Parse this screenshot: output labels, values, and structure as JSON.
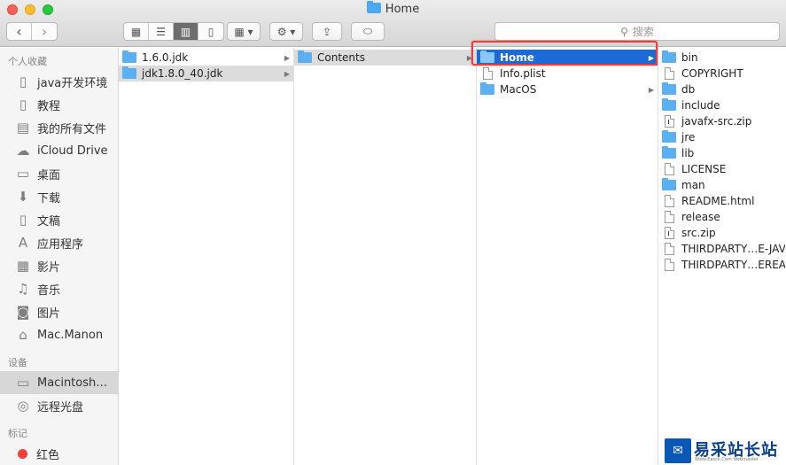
{
  "window": {
    "title": "Home",
    "buttons": {
      "close": "close",
      "minimize": "minimize",
      "zoom": "zoom"
    }
  },
  "toolbar": {
    "back_glyph": "‹",
    "forward_glyph": "›",
    "views": [
      {
        "name": "icon-view",
        "glyph": "▦",
        "active": false
      },
      {
        "name": "list-view",
        "glyph": "☰",
        "active": false
      },
      {
        "name": "column-view",
        "glyph": "▥",
        "active": true
      },
      {
        "name": "coverflow-view",
        "glyph": "▯",
        "active": false
      }
    ],
    "arrange_glyph": "▦ ▾",
    "action_glyph": "⚙ ▾",
    "share_glyph": "⇪",
    "tags_glyph": "⬭",
    "search_placeholder": "搜索"
  },
  "sidebar": {
    "sections": [
      {
        "heading": "个人收藏",
        "items": [
          {
            "label": "java开发环境",
            "icon": "document-icon",
            "glyph": "▯"
          },
          {
            "label": "教程",
            "icon": "document-icon",
            "glyph": "▯"
          },
          {
            "label": "我的所有文件",
            "icon": "all-files-icon",
            "glyph": "▤"
          },
          {
            "label": "iCloud Drive",
            "icon": "cloud-icon",
            "glyph": "☁"
          },
          {
            "label": "桌面",
            "icon": "desktop-icon",
            "glyph": "▭"
          },
          {
            "label": "下载",
            "icon": "download-icon",
            "glyph": "⬇"
          },
          {
            "label": "文稿",
            "icon": "documents-icon",
            "glyph": "▯"
          },
          {
            "label": "应用程序",
            "icon": "applications-icon",
            "glyph": "A"
          },
          {
            "label": "影片",
            "icon": "movies-icon",
            "glyph": "▦"
          },
          {
            "label": "音乐",
            "icon": "music-icon",
            "glyph": "♫"
          },
          {
            "label": "图片",
            "icon": "pictures-icon",
            "glyph": "◙"
          },
          {
            "label": "Mac.Manon",
            "icon": "home-icon",
            "glyph": "⌂"
          }
        ]
      },
      {
        "heading": "设备",
        "items": [
          {
            "label": "Macintosh…",
            "icon": "disk-icon",
            "glyph": "▭",
            "selected": true
          },
          {
            "label": "远程光盘",
            "icon": "optical-disc-icon",
            "glyph": "◎"
          }
        ]
      },
      {
        "heading": "标记",
        "items": [
          {
            "label": "红色",
            "icon": "red-tag-icon",
            "color": "#fc3d3a"
          }
        ]
      }
    ]
  },
  "columns": [
    {
      "items": [
        {
          "label": "1.6.0.jdk",
          "kind": "folder",
          "has_children": true
        },
        {
          "label": "jdk1.8.0_40.jdk",
          "kind": "folder",
          "has_children": true,
          "highlight": "gray"
        }
      ]
    },
    {
      "items": [
        {
          "label": "Contents",
          "kind": "folder",
          "has_children": true,
          "highlight": "gray"
        }
      ]
    },
    {
      "items": [
        {
          "label": "Home",
          "kind": "folder",
          "has_children": true,
          "highlight": "blue"
        },
        {
          "label": "Info.plist",
          "kind": "file"
        },
        {
          "label": "MacOS",
          "kind": "folder",
          "has_children": true
        }
      ]
    },
    {
      "items": [
        {
          "label": "bin",
          "kind": "folder"
        },
        {
          "label": "COPYRIGHT",
          "kind": "file"
        },
        {
          "label": "db",
          "kind": "folder"
        },
        {
          "label": "include",
          "kind": "folder"
        },
        {
          "label": "javafx-src.zip",
          "kind": "exec"
        },
        {
          "label": "jre",
          "kind": "folder"
        },
        {
          "label": "lib",
          "kind": "folder"
        },
        {
          "label": "LICENSE",
          "kind": "file"
        },
        {
          "label": "man",
          "kind": "folder"
        },
        {
          "label": "README.html",
          "kind": "file"
        },
        {
          "label": "release",
          "kind": "file"
        },
        {
          "label": "src.zip",
          "kind": "exec"
        },
        {
          "label": "THIRDPARTY…E-JAVAFX.txt",
          "kind": "file"
        },
        {
          "label": "THIRDPARTY…EREADME.txt",
          "kind": "file"
        }
      ]
    }
  ],
  "watermark": {
    "logo_glyph": "✉",
    "text": "易采站长站",
    "sub": "Www.Easck.Com Webmaster"
  },
  "colors": {
    "selection_blue": "#1b6ad7",
    "folder_blue": "#5bb0f2",
    "annotation_red": "#e5403d"
  }
}
